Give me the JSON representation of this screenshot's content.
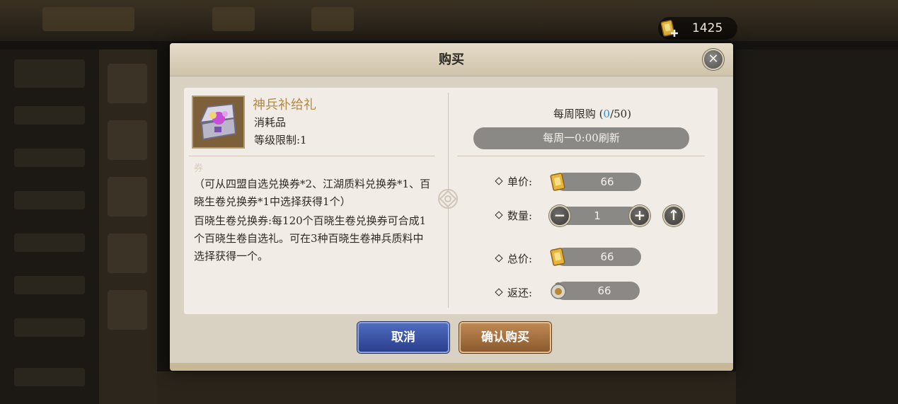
{
  "currency": {
    "amount": "1425",
    "icon": "gold-ticket-plus-icon"
  },
  "dialog": {
    "title": "购买",
    "close_icon": "close-icon"
  },
  "item": {
    "name": "神兵补给礼",
    "type": "消耗品",
    "level_limit": "等级限制:1",
    "faded_text": "券",
    "description": [
      "（可从四盟自选兑换券*2、江湖质料兑换券*1、百晓生卷兑换券*1中选择获得1个）",
      "百晓生卷兑换券:每120个百晓生卷兑换券可合成1个百晓生卷自选礼。可在3种百晓生卷神兵质料中选择获得一个。"
    ]
  },
  "purchase": {
    "limit_prefix": "每周限购 (",
    "limit_current": "0",
    "limit_suffix": "/50)",
    "refresh": "每周一0:00刷新",
    "unit_price_label": "单价:",
    "unit_price": "66",
    "quantity_label": "数量:",
    "quantity": "1",
    "total_label": "总价:",
    "total": "66",
    "rebate_label": "返还:",
    "rebate": "66",
    "minus_symbol": "−",
    "plus_symbol": "+",
    "max_symbol": "↑"
  },
  "buttons": {
    "cancel": "取消",
    "confirm": "确认购买"
  },
  "colors": {
    "item_name": "#b48a44",
    "limit_count": "#2a8fe0",
    "cancel_button": "#3a55a8",
    "confirm_button": "#a87340"
  }
}
